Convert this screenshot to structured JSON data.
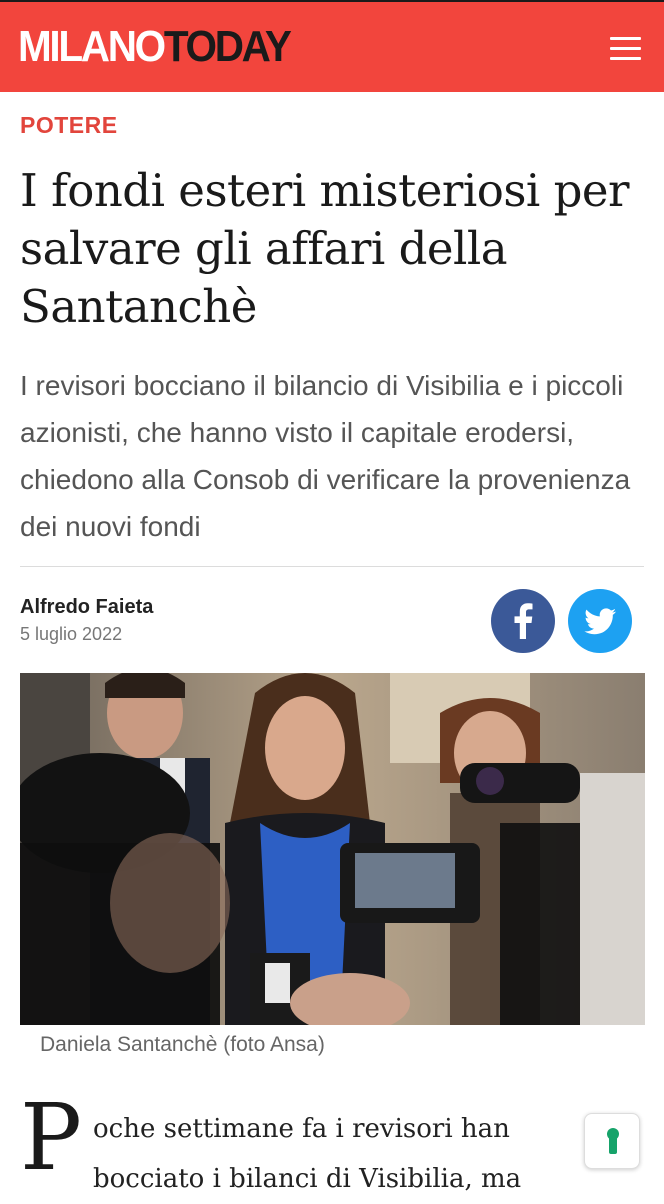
{
  "header": {
    "logo_part1": "MILANO",
    "logo_part2": "TODAY",
    "menu_icon": "hamburger-menu-icon",
    "brand_color": "#f2453d"
  },
  "article": {
    "category": "POTERE",
    "headline": "I fondi esteri misteriosi per salvare gli affari della Santanchè",
    "summary": "I revisori bocciano il bilancio di Visibilia e i piccoli azionisti, che hanno visto il capitale erodersi, chiedono alla Consob di verificare la provenienza dei nuovi fondi",
    "author": "Alfredo Faieta",
    "date": "5 luglio 2022",
    "share": {
      "facebook_icon": "facebook-icon",
      "twitter_icon": "twitter-icon",
      "facebook_color": "#3b5998",
      "twitter_color": "#1da1f2"
    },
    "image_caption": "Daniela Santanchè (foto Ansa)",
    "dropcap": "P",
    "body_lines": [
      "oche settimane fa i revisori han",
      "bocciato i bilanci di Visibilia, ma"
    ]
  },
  "accessibility_button": {
    "icon": "keyhole-icon"
  }
}
